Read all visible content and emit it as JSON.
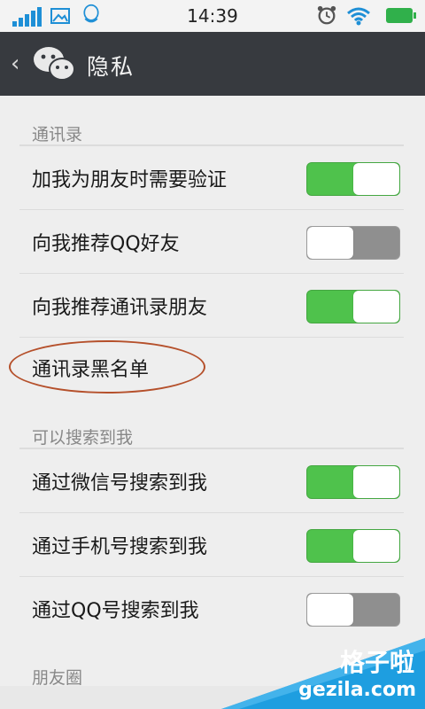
{
  "status_bar": {
    "time": "14:39",
    "icons": [
      "signal-icon",
      "image-icon",
      "qq-icon",
      "alarm-icon",
      "wifi-icon",
      "battery-icon"
    ]
  },
  "header": {
    "back_icon": "chevron-left-icon",
    "logo_icon": "wechat-logo-icon",
    "title": "隐私"
  },
  "sections": [
    {
      "title": "通讯录",
      "rows": [
        {
          "label": "加我为朋友时需要验证",
          "toggle": true
        },
        {
          "label": "向我推荐QQ好友",
          "toggle": false
        },
        {
          "label": "向我推荐通讯录朋友",
          "toggle": true
        },
        {
          "label": "通讯录黑名单"
        }
      ]
    },
    {
      "title": "可以搜索到我",
      "rows": [
        {
          "label": "通过微信号搜索到我",
          "toggle": true
        },
        {
          "label": "通过手机号搜索到我",
          "toggle": true
        },
        {
          "label": "通过QQ号搜索到我",
          "toggle": false
        }
      ]
    },
    {
      "title": "朋友圈"
    }
  ],
  "colors": {
    "toggle_on": "#4fc24c",
    "toggle_off": "#8f8f8f",
    "header_bg": "#373a3f",
    "annotation": "#b5502b",
    "watermark": "#1e9ee0"
  },
  "watermark": {
    "line1": "格子啦",
    "line2": "gezila.com"
  }
}
